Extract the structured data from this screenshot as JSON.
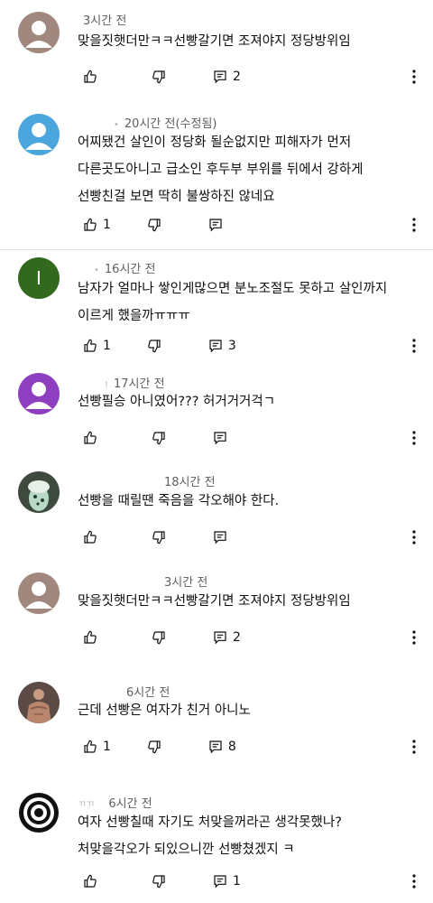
{
  "comments": [
    {
      "author": "",
      "time": "3시간 전",
      "text": "맞을짓햇더만ㅋㅋ선빵갈기면 조져야지 정당방위임",
      "likes": "",
      "replies": "2",
      "avatar": "gray"
    },
    {
      "author": "•",
      "time": "20시간 전(수정됨)",
      "text": "어찌됐건 살인이 정당화 될순없지만 피해자가 먼저\n다른곳도아니고 급소인 후두부 부위를 뒤에서 강하게\n선빵친걸 보면 딱히 불쌍하진 않네요",
      "likes": "1",
      "replies": "",
      "avatar": "blue"
    },
    {
      "author": "•",
      "time": "16시간 전",
      "text": "남자가 얼마나 쌓인게많으면 분노조절도 못하고 살인까지\n이르게 했을까ㅠㅠㅠ",
      "likes": "1",
      "replies": "3",
      "avatar": "letter",
      "avatar_letter": "I"
    },
    {
      "author": "!",
      "time": "17시간 전",
      "text": "선빵필승 아니였어??? 허거거거걱ㄱ",
      "likes": "",
      "replies": "",
      "avatar": "purple"
    },
    {
      "author": "",
      "time": "18시간 전",
      "text": "선빵을 때릴땐 죽음을 각오해야 한다.",
      "likes": "",
      "replies": "",
      "avatar": "photo-drink"
    },
    {
      "author": "",
      "time": "3시간 전",
      "text": "맞을짓햇더만ㅋㅋ선빵갈기면 조져야지 정당방위임",
      "likes": "",
      "replies": "2",
      "avatar": "gray"
    },
    {
      "author": "",
      "time": "6시간 전",
      "text": "근데 선빵은 여자가 친거 아니노",
      "likes": "1",
      "replies": "8",
      "avatar": "photo-person"
    },
    {
      "author": "ㄲㄲ",
      "time": "6시간 전",
      "text": "여자 선빵칠때 자기도 처맞을꺼라곤 생각못했나?\n처맞을각오가 되있으니깐 선빵쳤겠지 ㅋ",
      "likes": "",
      "replies": "1",
      "avatar": "target"
    }
  ],
  "colors": {
    "text": "#0f0f0f",
    "meta": "#606060",
    "divider": "#e5e5e5"
  },
  "icons": {
    "like": "thumbs-up-icon",
    "dislike": "thumbs-down-icon",
    "reply": "reply-comment-icon",
    "more": "more-vert-icon"
  }
}
